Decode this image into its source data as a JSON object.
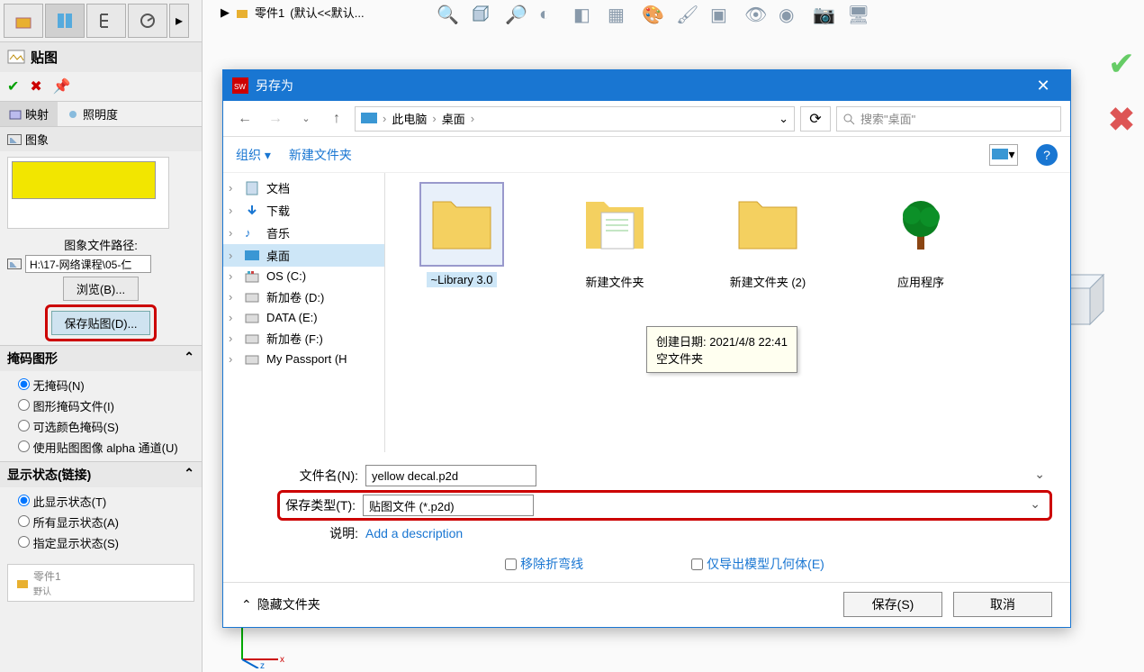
{
  "breadcrumb": {
    "part": "零件1",
    "state": "(默认<<默认..."
  },
  "panel": {
    "title": "贴图",
    "tabs": {
      "mapping": "映射",
      "lighting": "照明度"
    },
    "image_section": "图象",
    "path_label": "图象文件路径:",
    "path_value": "H:\\17-网络课程\\05-仁",
    "browse_btn": "浏览(B)...",
    "save_decal_btn": "保存贴图(D)...",
    "mask_header": "掩码图形",
    "mask_options": {
      "none": "无掩码(N)",
      "graphic": "图形掩码文件(I)",
      "color": "可选颜色掩码(S)",
      "alpha": "使用贴图图像 alpha 通道(U)"
    },
    "display_header": "显示状态(链接)",
    "display_options": {
      "this": "此显示状态(T)",
      "all": "所有显示状态(A)",
      "specify": "指定显示状态(S)"
    },
    "part_item": "零件1",
    "part_sub": "野认"
  },
  "dialog": {
    "title": "另存为",
    "crumbs": {
      "pc": "此电脑",
      "desktop": "桌面"
    },
    "search_placeholder": "搜索\"桌面\"",
    "organize": "组织",
    "new_folder": "新建文件夹",
    "tree": {
      "docs": "文档",
      "downloads": "下载",
      "music": "音乐",
      "desktop": "桌面",
      "osc": "OS (C:)",
      "newd": "新加卷 (D:)",
      "datae": "DATA (E:)",
      "newf": "新加卷 (F:)",
      "passport": "My Passport (H"
    },
    "files": {
      "library": "~Library 3.0",
      "folder1": "新建文件夹",
      "folder2": "新建文件夹 (2)",
      "app": "应用程序"
    },
    "tooltip": {
      "line1": "创建日期: 2021/4/8 22:41",
      "line2": "空文件夹"
    },
    "filename_label": "文件名(N):",
    "filename_value": "yellow decal.p2d",
    "savetype_label": "保存类型(T):",
    "savetype_value": "贴图文件 (*.p2d)",
    "desc_label": "说明:",
    "desc_value": "Add a description",
    "remove_bends": "移除折弯线",
    "export_only": "仅导出模型几何体(E)",
    "hide_folders": "隐藏文件夹",
    "save_btn": "保存(S)",
    "cancel_btn": "取消"
  }
}
